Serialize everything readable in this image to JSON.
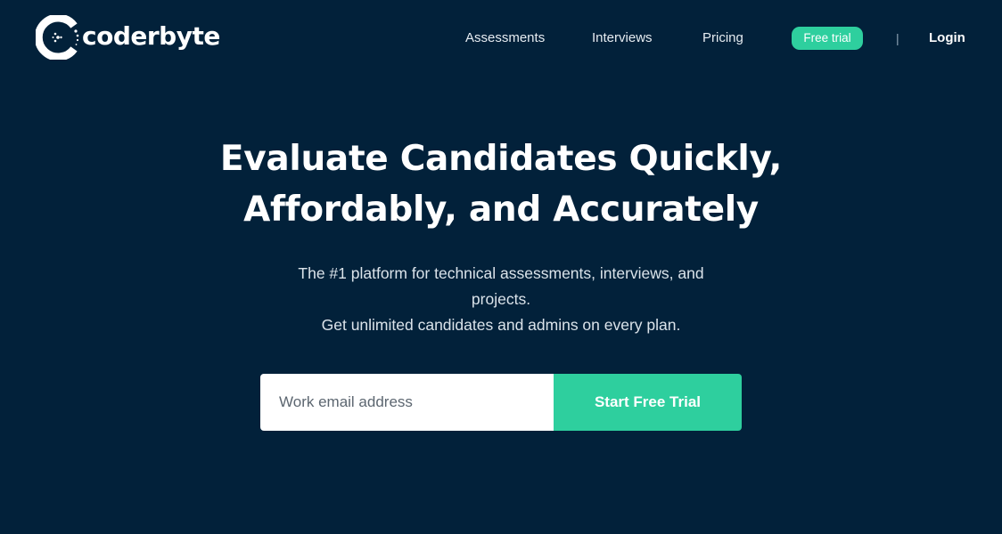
{
  "brand": {
    "name": "coderbyte",
    "logo_icon": "coderbyte-logo-icon"
  },
  "nav": {
    "items": [
      {
        "label": "Assessments"
      },
      {
        "label": "Interviews"
      },
      {
        "label": "Pricing"
      }
    ],
    "free_trial_label": "Free trial",
    "divider": "|",
    "login_label": "Login"
  },
  "hero": {
    "title_line1": "Evaluate Candidates Quickly,",
    "title_line2": "Affordably, and Accurately",
    "subtitle_line1": "The #1 platform for technical assessments, interviews, and",
    "subtitle_line2": "projects.",
    "subtitle_line3": "Get unlimited candidates and admins on every plan."
  },
  "signup": {
    "email_placeholder": "Work email address",
    "email_value": "",
    "submit_label": "Start Free Trial"
  },
  "colors": {
    "background": "#02213a",
    "accent": "#2ecf9e",
    "text": "#ffffff"
  }
}
